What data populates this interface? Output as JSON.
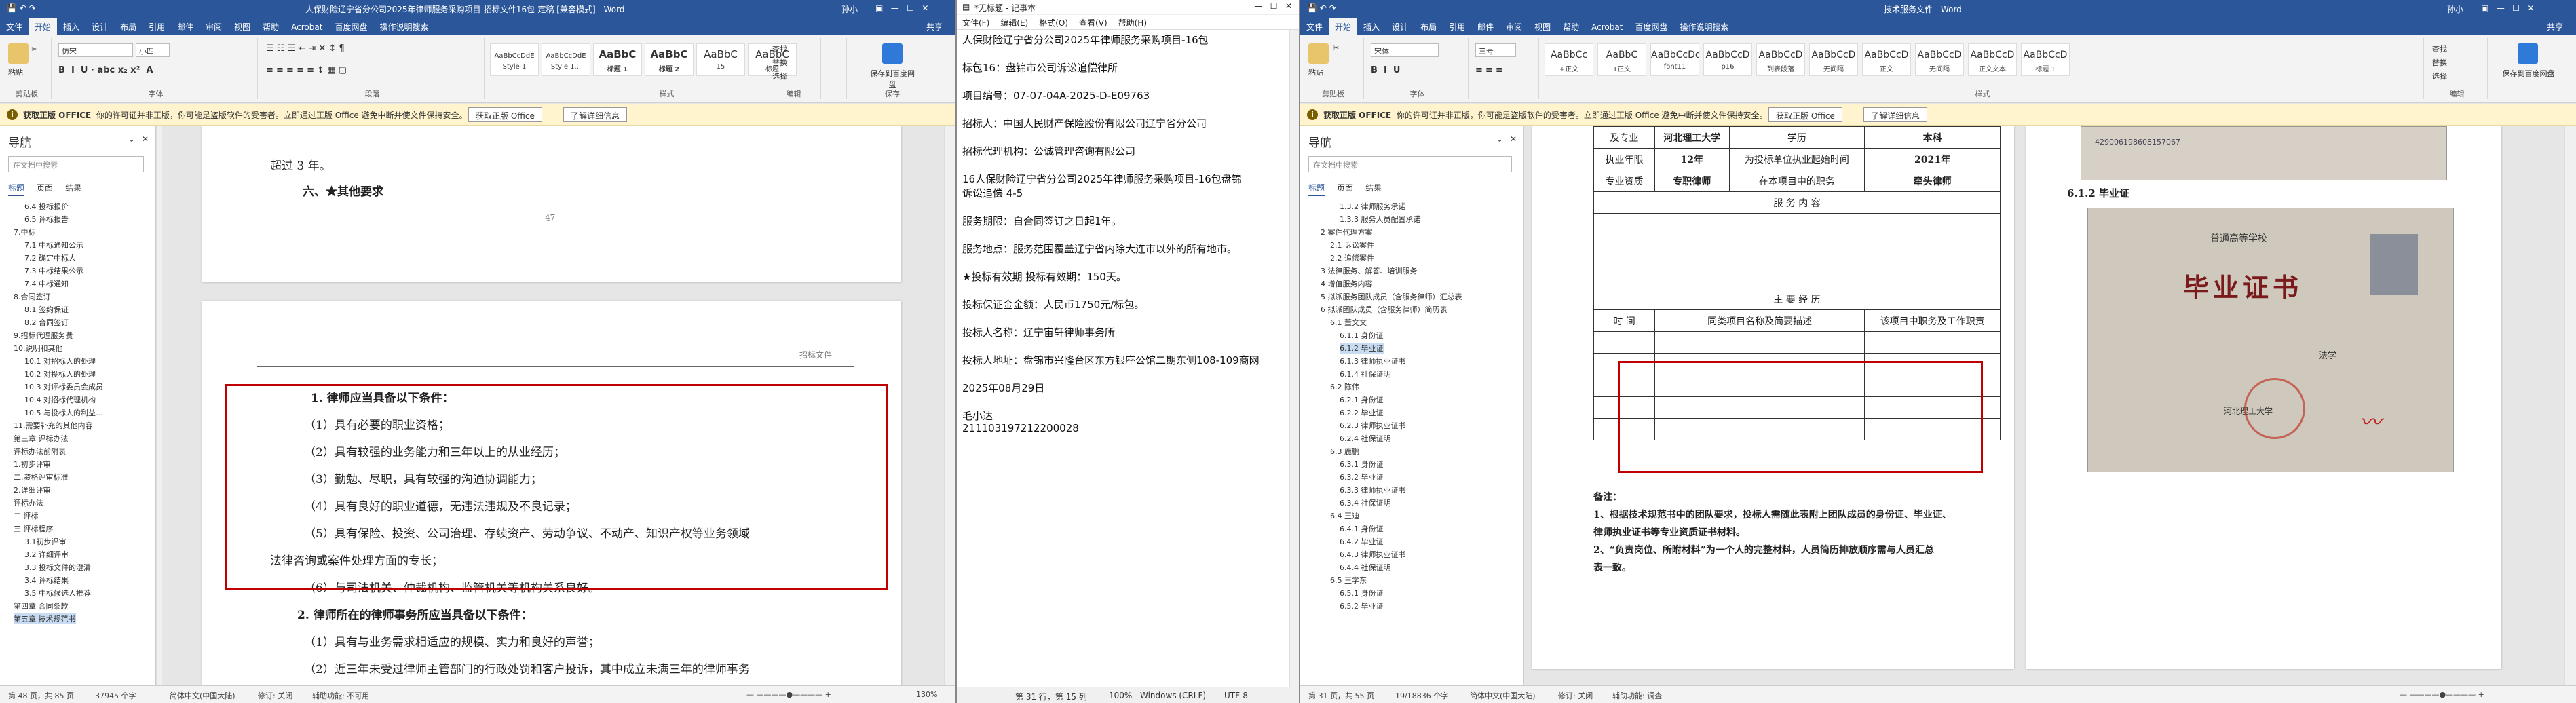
{
  "left": {
    "title": "人保财险辽宁省分公司2025年律师服务采购项目-招标文件16包-定稿 [兼容模式] - Word",
    "user": "孙小",
    "tabs": [
      "文件",
      "开始",
      "插入",
      "设计",
      "布局",
      "引用",
      "邮件",
      "审阅",
      "视图",
      "帮助",
      "Acrobat",
      "百度网盘",
      "操作说明搜索"
    ],
    "share": "共享",
    "ribbon": {
      "clipboard": "剪贴板",
      "font": "字体",
      "paragraph": "段落",
      "styles": "样式",
      "editing": "编辑",
      "save": "保存",
      "paste": "粘贴",
      "font_name": "仿宋",
      "font_size": "小四",
      "find": "查找",
      "replace": "替换",
      "select": "选择",
      "save_baidu": "保存到百度网盘",
      "style_items": [
        {
          "sample": "AaBbCcDdE",
          "name": "Style 1"
        },
        {
          "sample": "AaBbCcDdE",
          "name": "Style 1..."
        },
        {
          "sample": "AaBbC",
          "name": "标题 1"
        },
        {
          "sample": "AaBbC",
          "name": "标题 2"
        },
        {
          "sample": "AaBbC",
          "name": "15"
        },
        {
          "sample": "AaBbC",
          "name": "标题"
        }
      ]
    },
    "warn": {
      "title": "获取正版 OFFICE",
      "text": "你的许可证并非正版，你可能是盗版软件的受害者。立即通过正版 Office 避免中断并使文件保持安全。",
      "btn1": "获取正版 Office",
      "btn2": "了解详细信息"
    },
    "nav": {
      "heading": "导航",
      "search": "在文档中搜索",
      "tabs": [
        "标题",
        "页面",
        "结果"
      ],
      "items": [
        "6.4 投标报价",
        "6.5 评标报告",
        "7.中标",
        "7.1 中标通知公示",
        "7.2 确定中标人",
        "7.3 中标结果公示",
        "7.4 中标通知",
        "8.合同签订",
        "8.1 签约保证",
        "8.2 合同签订",
        "9.招标代理服务费",
        "10.说明和其他",
        "10.1 对招标人的处理",
        "10.2 对投标人的处理",
        "10.3 对评标委员会成员",
        "10.4 对招标代理机构",
        "10.5 与投标人的利益...",
        "11.需要补充的其他内容",
        "第三章 评标办法",
        "评标办法前附表",
        "1.初步评审",
        "二.资格评审标准",
        "2.详细评审",
        "评标办法",
        "二.评标",
        "三.评标程序",
        "3.1初步评审",
        "3.2 详细评审",
        "3.3 投标文件的澄清",
        "3.4 评标结果",
        "3.5 中标候选人推荐",
        "第四章 合同条款",
        "第五章 技术规范书"
      ]
    },
    "page1": {
      "para": "超过 3 年。",
      "heading": "六、★其他要求",
      "pagenum": "47"
    },
    "page2": {
      "header": "招标文件",
      "lines": [
        "1. 律师应当具备以下条件：",
        "（1）具有必要的职业资格；",
        "（2）具有较强的业务能力和三年以上的从业经历；",
        "（3）勤勉、尽职，具有较强的沟通协调能力；",
        "（4）具有良好的职业道德，无违法违规及不良记录；",
        "（5）具有保险、投资、公司治理、存续资产、劳动争议、不动产、知识产权等业务领域",
        "法律咨询或案件处理方面的专长；",
        "（6）与司法机关、仲裁机构、监管机关等机构关系良好。",
        "2. 律师所在的律师事务所应当具备以下条件：",
        "（1）具有与业务需求相适应的规模、实力和良好的声誉；",
        "（2）近三年未受过律师主管部门的行政处罚和客户投诉，其中成立未满三年的律师事务"
      ]
    },
    "status": {
      "page": "第 48 页，共 85 页",
      "words": "37945 个字",
      "lang": "简体中文(中国大陆)",
      "track": "修订: 关闭",
      "access": "辅助功能: 不可用",
      "zoom": "130%"
    }
  },
  "notepad": {
    "title": "*无标题 - 记事本",
    "menu": [
      "文件(F)",
      "编辑(E)",
      "格式(O)",
      "查看(V)",
      "帮助(H)"
    ],
    "lines": [
      "人保财险辽宁省分公司2025年律师服务采购项目-16包",
      "",
      "标包16：盘锦市公司诉讼追偿律所",
      "",
      "项目编号：07-07-04A-2025-D-E09763",
      "",
      "招标人：中国人民财产保险股份有限公司辽宁省分公司",
      "",
      "招标代理机构：公诚管理咨询有限公司",
      "",
      "16人保财险辽宁省分公司2025年律师服务采购项目-16包盘锦",
      "诉讼追偿  4-5",
      "",
      "服务期限：自合同签订之日起1年。",
      "",
      "服务地点：服务范围覆盖辽宁省内除大连市以外的所有地市。",
      "",
      "★投标有效期        投标有效期：150天。",
      "",
      "投标保证金金额：人民币1750元/标包。",
      "",
      "投标人名称：辽宁宙轩律师事务所",
      "",
      "投标人地址：盘锦市兴隆台区东方银座公馆二期东侧108-109商网",
      "",
      "2025年08月29日",
      "",
      "毛小达",
      "211103197212200028"
    ],
    "status": {
      "pos": "第 31 行，第 15 列",
      "zoom": "100%",
      "eol": "Windows (CRLF)",
      "enc": "UTF-8"
    }
  },
  "right": {
    "title": "技术服务文件 - Word",
    "user": "孙小",
    "tabs": [
      "文件",
      "开始",
      "插入",
      "设计",
      "布局",
      "引用",
      "邮件",
      "审阅",
      "视图",
      "帮助",
      "Acrobat",
      "百度网盘",
      "操作说明搜索"
    ],
    "share": "共享",
    "ribbon": {
      "font_name": "宋体",
      "font_size": "三号",
      "style_items": [
        {
          "sample": "AaBbCc",
          "name": "+正文"
        },
        {
          "sample": "AaBbC",
          "name": "1正文"
        },
        {
          "sample": "AaBbCcDd",
          "name": "font11"
        },
        {
          "sample": "AaBbCcD",
          "name": "p16"
        },
        {
          "sample": "AaBbCcD",
          "name": "列表段落"
        },
        {
          "sample": "AaBbCcD",
          "name": "无间隔"
        },
        {
          "sample": "AaBbCcD",
          "name": "正文"
        },
        {
          "sample": "AaBbCcD",
          "name": "无间隔"
        },
        {
          "sample": "AaBbCcD",
          "name": "正文文本"
        },
        {
          "sample": "AaBbCcD",
          "name": "标题 1"
        }
      ]
    },
    "nav": {
      "items": [
        "1.3.2 律师服务承诺",
        "1.3.3 服务人员配置承诺",
        "2 案件代理方案",
        "2.1 诉讼案件",
        "2.2 追偿案件",
        "3 法律服务、解答、培训服务",
        "4 增值服务内容",
        "5 拟派服务团队成员（含服务律师）汇总表",
        "6 拟派团队成员（含服务律师）简历表",
        "6.1 董文文",
        "6.1.1 身份证",
        "6.1.2 毕业证",
        "6.1.3 律师执业证书",
        "6.1.4 社保证明",
        "6.2 陈伟",
        "6.2.1 身份证",
        "6.2.2 毕业证",
        "6.2.3 律师执业证书",
        "6.2.4 社保证明",
        "6.3 鹿鹏",
        "6.3.1 身份证",
        "6.3.2 毕业证",
        "6.3.3 律师执业证书",
        "6.3.4 社保证明",
        "6.4 王迪",
        "6.4.1 身份证",
        "6.4.2 毕业证",
        "6.4.3 律师执业证书",
        "6.4.4 社保证明",
        "6.5 王学东",
        "6.5.1 身份证",
        "6.5.2 毕业证"
      ]
    },
    "table": {
      "r1": [
        "及专业",
        "河北理工大学",
        "学历",
        "本科"
      ],
      "r2": [
        "执业年限",
        "12年",
        "为投标单位执业起始时间",
        "2021年"
      ],
      "r3": [
        "专业资质",
        "专职律师",
        "在本项目中的职务",
        "牵头律师"
      ],
      "service": "服 务 内 容",
      "exp": "主 要 经 历",
      "cols": [
        "时 间",
        "同类项目名称及简要描述",
        "该项目中职务及工作职责"
      ]
    },
    "notes": {
      "label": "备注：",
      "n1": "1、根据技术规范书中的团队要求，投标人需随此表附上团队成员的身份证、毕业证、",
      "n1b": "律师执业证书等专业资质证书材料。",
      "n2": "2、“负责岗位、所附材料”为一个人的完整材料，人员简历排放顺序需与人员汇总",
      "n2b": "表一致。"
    },
    "section": "6.1.2 毕业证",
    "cert": {
      "school": "普通高等学校",
      "title": "毕业证书",
      "serial": "429006198608157067",
      "major": "法学",
      "univ": "河北理工大学"
    },
    "status": {
      "page": "第 31 页，共 55 页",
      "words": "19/18836 个字",
      "lang": "简体中文(中国大陆)",
      "track": "修订: 关闭",
      "access": "辅助功能: 调查"
    }
  }
}
